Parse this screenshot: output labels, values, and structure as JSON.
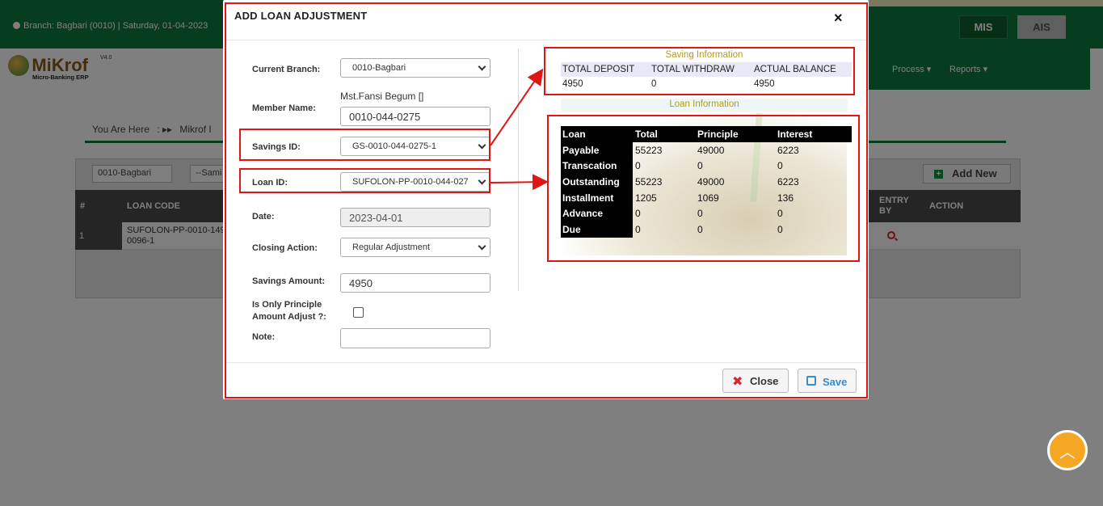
{
  "background": {
    "branch_info": "Branch: Bagbari (0010) | Saturday, 01-04-2023",
    "buttons": {
      "mis": "MIS",
      "ais": "AIS"
    },
    "logo": {
      "name": "MiKrof",
      "version": "V4.0",
      "subtitle": "Micro-Banking ERP"
    },
    "nav": {
      "process": "Process",
      "reports": "Reports"
    },
    "breadcrumb": {
      "label": "You Are Here",
      "item": "Mikrof I"
    },
    "filters": {
      "branch": "0010-Bagbari",
      "samity": "--Sami"
    },
    "add_new": "Add New",
    "table": {
      "headers": {
        "num": "#",
        "loan_code": "LOAN CODE",
        "entry_by": "ENTRY BY",
        "action": "ACTION"
      },
      "row": {
        "num": "1",
        "loan_code_1": "SUFOLON-PP-0010-149",
        "loan_code_2": "0096-1"
      }
    }
  },
  "modal": {
    "title": "ADD LOAN ADJUSTMENT",
    "form": {
      "current_branch_label": "Current Branch:",
      "current_branch_value": "0010-Bagbari",
      "member_name_label": "Member Name:",
      "member_name_display": "Mst.Fansi Begum []",
      "member_id_value": "0010-044-0275",
      "savings_id_label": "Savings ID:",
      "savings_id_value": "GS-0010-044-0275-1",
      "loan_id_label": "Loan ID:",
      "loan_id_value": "SUFOLON-PP-0010-044-027",
      "date_label": "Date:",
      "date_value": "2023-04-01",
      "closing_action_label": "Closing Action:",
      "closing_action_value": "Regular Adjustment",
      "savings_amount_label": "Savings Amount:",
      "savings_amount_value": "4950",
      "principle_only_label_1": "Is Only Principle",
      "principle_only_label_2": "Amount Adjust ?:",
      "note_label": "Note:"
    },
    "saving_info": {
      "title": "Saving Information",
      "headers": {
        "total_deposit": "TOTAL DEPOSIT",
        "total_withdraw": "TOTAL WITHDRAW",
        "actual_balance": "ACTUAL BALANCE"
      },
      "values": {
        "total_deposit": "4950",
        "total_withdraw": "0",
        "actual_balance": "4950"
      }
    },
    "loan_info": {
      "title": "Loan Information",
      "headers": {
        "c0": "Loan",
        "c1": "Total",
        "c2": "Principle",
        "c3": "Interest"
      },
      "rows": [
        {
          "c0": "Payable",
          "c1": "55223",
          "c2": "49000",
          "c3": "6223"
        },
        {
          "c0": "Transcation",
          "c1": "0",
          "c2": "0",
          "c3": "0"
        },
        {
          "c0": "Outstanding",
          "c1": "55223",
          "c2": "49000",
          "c3": "6223"
        },
        {
          "c0": "Installment",
          "c1": "1205",
          "c2": "1069",
          "c3": "136"
        },
        {
          "c0": "Advance",
          "c1": "0",
          "c2": "0",
          "c3": "0"
        },
        {
          "c0": "Due",
          "c1": "0",
          "c2": "0",
          "c3": "0"
        }
      ]
    },
    "buttons": {
      "close": "Close",
      "save": "Save"
    },
    "close_icon": "×"
  },
  "icons": {
    "scroll_top": "chevron-up-icon",
    "close": "close-icon",
    "save": "floppy-icon",
    "add": "plus-icon",
    "search": "search-icon"
  },
  "colors": {
    "brand_green": "#0b7a3c",
    "annotation_red": "#e01515",
    "scroll_top": "#f5a623"
  }
}
